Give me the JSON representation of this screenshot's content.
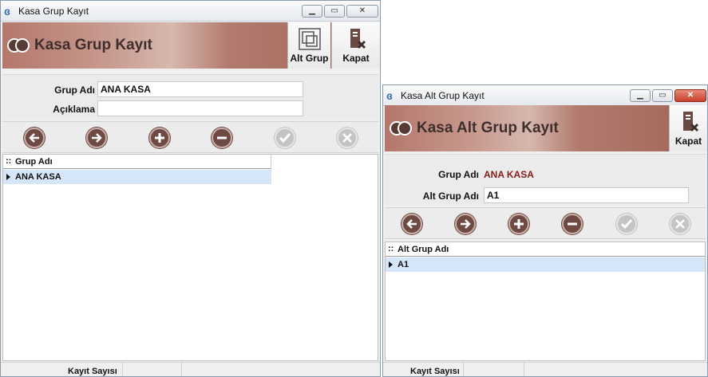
{
  "window1": {
    "title": "Kasa Grup Kayıt",
    "banner_title": "Kasa Grup Kayıt",
    "alt_grup_button": "Alt Grup",
    "kapat_button": "Kapat",
    "form": {
      "grup_adi_label": "Grup Adı",
      "grup_adi_value": "ANA KASA",
      "aciklama_label": "Açıklama",
      "aciklama_value": ""
    },
    "grid": {
      "column": "Grup Adı",
      "rows": [
        "ANA KASA"
      ]
    },
    "footer": "Kayıt Sayısı"
  },
  "window2": {
    "title": "Kasa Alt Grup Kayıt",
    "banner_title": "Kasa Alt Grup Kayıt",
    "kapat_button": "Kapat",
    "form": {
      "grup_adi_label": "Grup Adı",
      "grup_adi_value": "ANA KASA",
      "alt_grup_adi_label": "Alt Grup Adı",
      "alt_grup_adi_value": "A1"
    },
    "grid": {
      "column": "Alt Grup Adı",
      "rows": [
        "A1"
      ]
    },
    "footer": "Kayıt Sayısı"
  },
  "icons": [
    "app-icon",
    "minimize-icon",
    "maximize-icon",
    "close-icon",
    "brand-logo-icon",
    "subgroup-icon",
    "exit-door-icon",
    "prev-arrow-icon",
    "next-arrow-icon",
    "add-icon",
    "remove-icon",
    "confirm-check-icon",
    "cancel-x-icon"
  ],
  "colors": {
    "banner_accent": "#b4776b",
    "value_red": "#8b1a1a",
    "selected_row": "#d5e6f8",
    "nav_active": "#6e4a43",
    "nav_disabled": "#c4c4c4"
  }
}
